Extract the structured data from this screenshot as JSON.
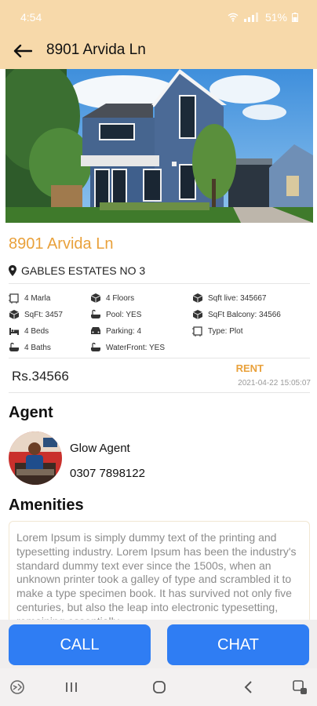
{
  "status": {
    "time": "4:54",
    "battery": "51%"
  },
  "appbar": {
    "title": "8901 Arvida Ln"
  },
  "property": {
    "title": "8901 Arvida Ln",
    "location": "GABLES ESTATES NO 3",
    "features": [
      {
        "label": "4 Marla",
        "icon": "area-icon"
      },
      {
        "label": "4 Floors",
        "icon": "cube-icon"
      },
      {
        "label": "Sqft live: 345667",
        "icon": "cube-icon"
      },
      {
        "label": "SqFt: 3457",
        "icon": "cube-icon"
      },
      {
        "label": "Pool: YES",
        "icon": "bathtub-icon"
      },
      {
        "label": "SqFt Balcony: 34566",
        "icon": "cube-icon"
      },
      {
        "label": "4 Beds",
        "icon": "bed-icon"
      },
      {
        "label": "Parking: 4",
        "icon": "parking-icon"
      },
      {
        "label": "Type: Plot",
        "icon": "area-icon"
      },
      {
        "label": "4 Baths",
        "icon": "bathtub-icon"
      },
      {
        "label": "WaterFront: YES",
        "icon": "bathtub-icon"
      }
    ],
    "price": "Rs.34566",
    "purpose": "RENT",
    "date": "2021-04-22 15:05:07"
  },
  "agent": {
    "heading": "Agent",
    "name": "Glow Agent",
    "phone": "0307 7898122"
  },
  "amenities": {
    "heading": "Amenities",
    "text": "Lorem Ipsum is simply dummy text of the printing and typesetting industry. Lorem Ipsum has been the industry's standard dummy text ever since the 1500s, when an unknown printer took a galley of type and scrambled it to make a type specimen book. It has survived not only five centuries, but also the leap into electronic typesetting, remaining essentially"
  },
  "actions": {
    "call": "CALL",
    "chat": "CHAT"
  },
  "colors": {
    "header_bg": "#f7d9aa",
    "accent": "#e9a13b",
    "button": "#2f7df3"
  }
}
